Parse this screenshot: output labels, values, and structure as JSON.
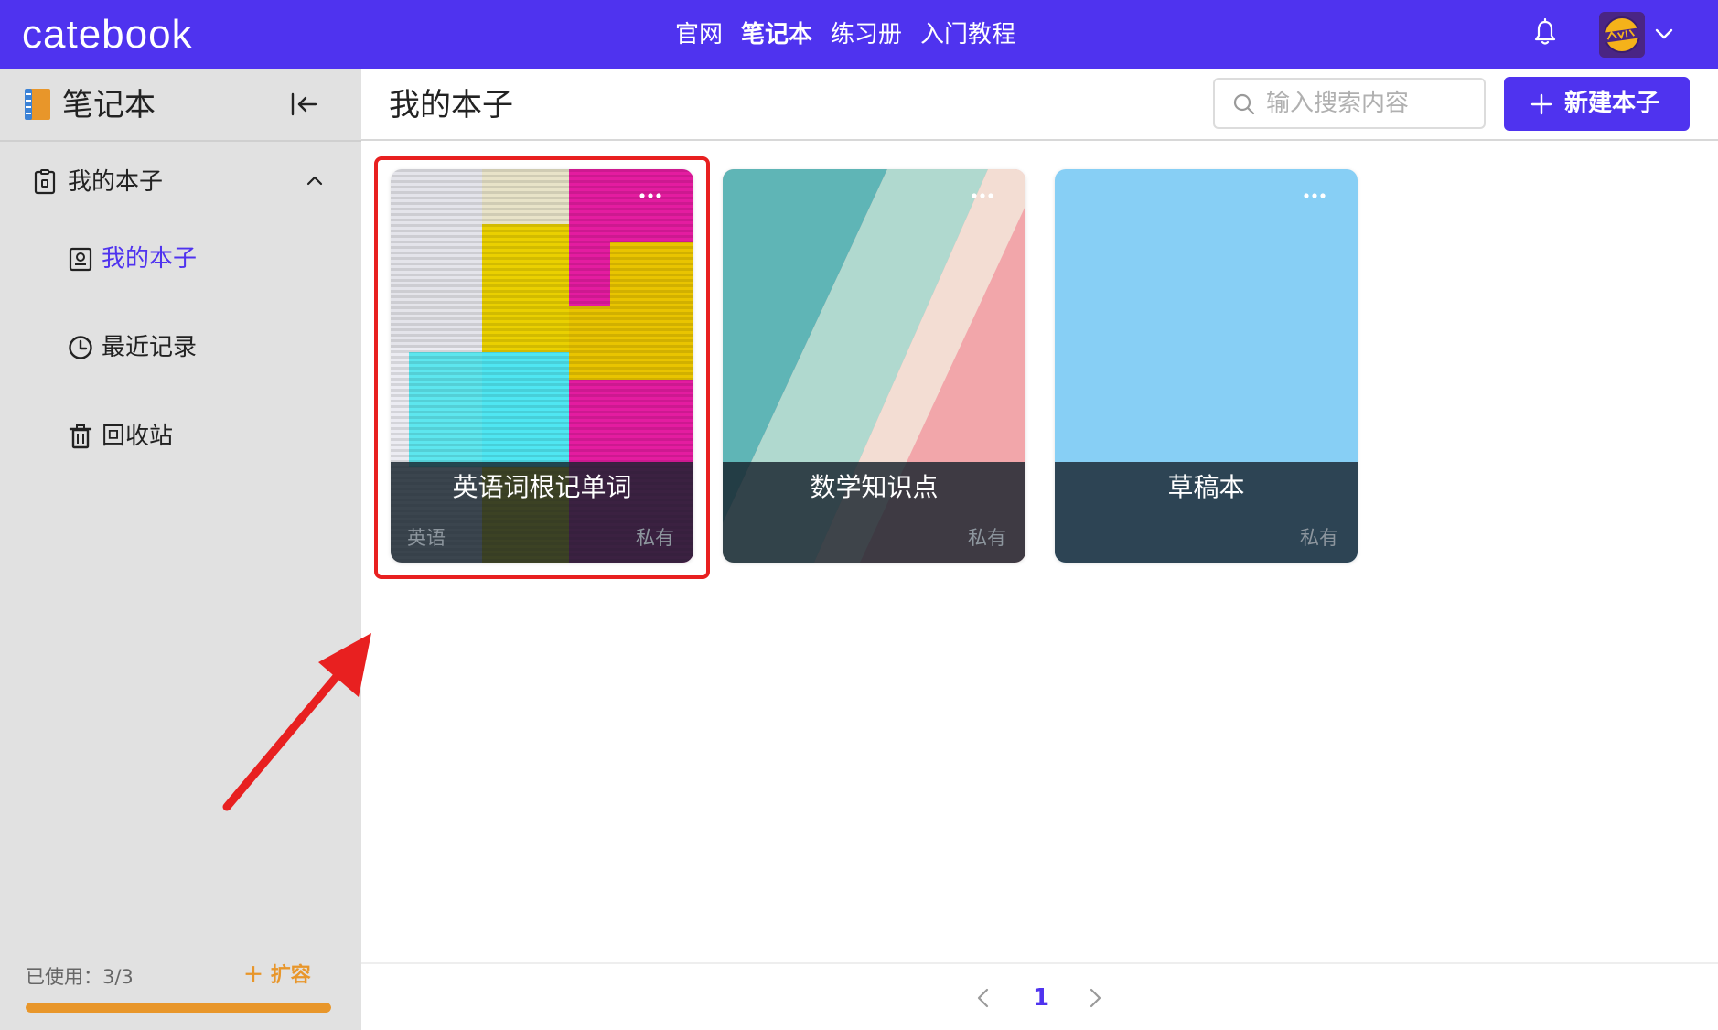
{
  "header": {
    "brand": "catebook",
    "nav": [
      {
        "label": "官网",
        "active": false
      },
      {
        "label": "笔记本",
        "active": true
      },
      {
        "label": "练习册",
        "active": false
      },
      {
        "label": "入门教程",
        "active": false
      }
    ],
    "icons": {
      "bell": "bell-icon",
      "avatar": "user-avatar",
      "menu": "chevron-down-icon"
    },
    "color": "#4f33ef"
  },
  "sidebar": {
    "title": "笔记本",
    "group": {
      "label": "我的本子",
      "expanded": true
    },
    "items": [
      {
        "label": "我的本子",
        "icon": "notebook-icon",
        "active": true
      },
      {
        "label": "最近记录",
        "icon": "clock-icon",
        "active": false
      },
      {
        "label": "回收站",
        "icon": "trash-icon",
        "active": false
      }
    ],
    "usage": {
      "label": "已使用：3/3",
      "used": 3,
      "total": 3
    },
    "expand_label": "扩容",
    "accent": "#e8962a"
  },
  "main": {
    "title": "我的本子",
    "search": {
      "placeholder": "输入搜索内容",
      "value": ""
    },
    "new_button": "新建本子",
    "cards": [
      {
        "title": "英语词根记单词",
        "tag": "英语",
        "privacy": "私有",
        "cover": "glitch-stripes",
        "highlighted": true
      },
      {
        "title": "数学知识点",
        "tag": "",
        "privacy": "私有",
        "cover": "diagonal-teal-pink",
        "highlighted": false
      },
      {
        "title": "草稿本",
        "tag": "",
        "privacy": "私有",
        "cover": "solid-sky-blue",
        "highlighted": false
      }
    ]
  },
  "pagination": {
    "current": "1"
  },
  "annotation": {
    "color": "#e82020"
  }
}
